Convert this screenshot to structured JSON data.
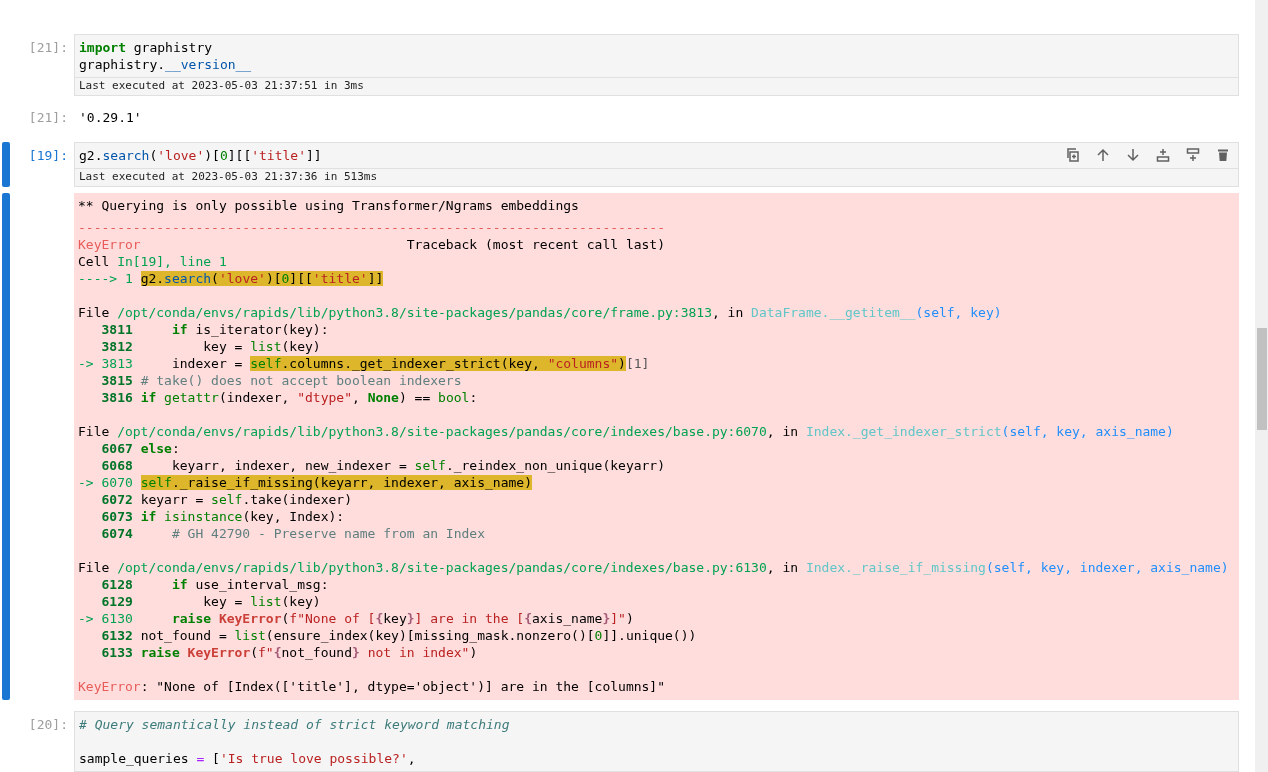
{
  "cells": [
    {
      "kind": "code",
      "prompt": "[21]:",
      "active": false,
      "show_toolbar": false,
      "status": "Last executed at 2023-05-03 21:37:51 in 3ms",
      "blocks": [
        [
          [
            {
              "kind": "kw",
              "text": "import"
            },
            {
              "kind": "plain",
              "text": " graphistry"
            }
          ],
          [
            {
              "kind": "plain",
              "text": "graphistry."
            },
            {
              "kind": "attr",
              "text": "__version__"
            }
          ]
        ]
      ]
    },
    {
      "kind": "result",
      "prompt": "[21]:",
      "active": false,
      "text": "'0.29.1'"
    },
    {
      "kind": "code",
      "prompt": "[19]:",
      "active": true,
      "show_toolbar": true,
      "status": "Last executed at 2023-05-03 21:37:36 in 513ms",
      "blocks": [
        [
          [
            {
              "kind": "plain",
              "text": "g2."
            },
            {
              "kind": "attr",
              "text": "search"
            },
            {
              "kind": "plain",
              "text": "("
            },
            {
              "kind": "str",
              "text": "'love'"
            },
            {
              "kind": "plain",
              "text": ")["
            },
            {
              "kind": "num",
              "text": "0"
            },
            {
              "kind": "plain",
              "text": "][["
            },
            {
              "kind": "str",
              "text": "'title'"
            },
            {
              "kind": "plain",
              "text": "]]"
            }
          ]
        ]
      ]
    },
    {
      "kind": "error",
      "active": true,
      "blocks": [
        [
          [
            {
              "kind": "plain",
              "text": "** Querying is only possible using Transformer/Ngrams embeddings"
            }
          ],
          [
            {
              "kind": "ared",
              "text": "---------------------------------------------------------------------------"
            }
          ],
          [
            {
              "kind": "ared",
              "text": "KeyError"
            },
            {
              "kind": "plain",
              "text": "                                  Traceback (most recent call last)"
            }
          ],
          [
            {
              "kind": "plain",
              "text": "Cell "
            },
            {
              "kind": "agreen",
              "text": "In[19], line 1"
            }
          ],
          [
            {
              "kind": "agreen",
              "text": "----> 1 "
            },
            {
              "kind": "plain",
              "text": "g2.",
              "highlighted": true
            },
            {
              "kind": "attr",
              "text": "search",
              "highlighted": true
            },
            {
              "kind": "plain",
              "text": "(",
              "highlighted": true
            },
            {
              "kind": "str",
              "text": "'love'",
              "highlighted": true
            },
            {
              "kind": "plain",
              "text": ")[",
              "highlighted": true
            },
            {
              "kind": "num",
              "text": "0",
              "highlighted": true
            },
            {
              "kind": "plain",
              "text": "][[",
              "highlighted": true
            },
            {
              "kind": "str",
              "text": "'title'",
              "highlighted": true
            },
            {
              "kind": "plain",
              "text": "]]",
              "highlighted": true
            }
          ]
        ],
        [
          [
            {
              "kind": "plain",
              "text": "File "
            },
            {
              "kind": "agreen",
              "text": "/opt/conda/envs/rapids/lib/python3.8/site-packages/pandas/core/frame.py:3813"
            },
            {
              "kind": "plain",
              "text": ", in "
            },
            {
              "kind": "acyan",
              "text": "DataFrame.__getitem__"
            },
            {
              "kind": "ablue",
              "text": "(self, key)"
            }
          ],
          [
            {
              "kind": "lineno",
              "text": "   3811     "
            },
            {
              "kind": "kw",
              "text": "if"
            },
            {
              "kind": "plain",
              "text": " is_iterator(key):"
            }
          ],
          [
            {
              "kind": "lineno",
              "text": "   3812         "
            },
            {
              "kind": "plain",
              "text": "key = "
            },
            {
              "kind": "builtin",
              "text": "list"
            },
            {
              "kind": "plain",
              "text": "(key)"
            }
          ],
          [
            {
              "kind": "agreen",
              "text": "-> 3813     "
            },
            {
              "kind": "plain",
              "text": "indexer = "
            },
            {
              "kind": "builtin",
              "text": "self",
              "highlighted": true
            },
            {
              "kind": "plain",
              "text": ".columns._get_indexer_strict(key, ",
              "highlighted": true
            },
            {
              "kind": "str",
              "text": "\"columns\"",
              "highlighted": true
            },
            {
              "kind": "plain",
              "text": ")",
              "highlighted": true
            },
            {
              "kind": "dim",
              "text": "[1]"
            }
          ],
          [
            {
              "kind": "lineno",
              "text": "   3815 "
            },
            {
              "kind": "comment",
              "text": "# take() does not accept boolean indexers"
            }
          ],
          [
            {
              "kind": "lineno",
              "text": "   3816 "
            },
            {
              "kind": "kw",
              "text": "if"
            },
            {
              "kind": "builtin",
              "text": " getattr"
            },
            {
              "kind": "plain",
              "text": "(indexer, "
            },
            {
              "kind": "str",
              "text": "\"dtype\""
            },
            {
              "kind": "plain",
              "text": ", "
            },
            {
              "kind": "kw",
              "text": "None"
            },
            {
              "kind": "plain",
              "text": ") == "
            },
            {
              "kind": "builtin",
              "text": "bool"
            },
            {
              "kind": "plain",
              "text": ":"
            }
          ]
        ],
        [
          [
            {
              "kind": "plain",
              "text": "File "
            },
            {
              "kind": "agreen",
              "text": "/opt/conda/envs/rapids/lib/python3.8/site-packages/pandas/core/indexes/base.py:6070"
            },
            {
              "kind": "plain",
              "text": ", in "
            },
            {
              "kind": "acyan",
              "text": "Index._get_indexer_strict"
            },
            {
              "kind": "ablue",
              "text": "(self, key, axis_name)"
            }
          ],
          [
            {
              "kind": "lineno",
              "text": "   6067 "
            },
            {
              "kind": "kw",
              "text": "else"
            },
            {
              "kind": "plain",
              "text": ":"
            }
          ],
          [
            {
              "kind": "lineno",
              "text": "   6068     "
            },
            {
              "kind": "plain",
              "text": "keyarr, indexer, new_indexer = "
            },
            {
              "kind": "builtin",
              "text": "self"
            },
            {
              "kind": "plain",
              "text": "._reindex_non_unique(keyarr)"
            }
          ],
          [
            {
              "kind": "agreen",
              "text": "-> 6070 "
            },
            {
              "kind": "builtin",
              "text": "self",
              "highlighted": true
            },
            {
              "kind": "plain",
              "text": "._raise_if_missing(keyarr, indexer, axis_name)",
              "highlighted": true
            }
          ],
          [
            {
              "kind": "lineno",
              "text": "   6072 "
            },
            {
              "kind": "plain",
              "text": "keyarr = "
            },
            {
              "kind": "builtin",
              "text": "self"
            },
            {
              "kind": "plain",
              "text": ".take(indexer)"
            }
          ],
          [
            {
              "kind": "lineno",
              "text": "   6073 "
            },
            {
              "kind": "kw",
              "text": "if"
            },
            {
              "kind": "builtin",
              "text": " isinstance"
            },
            {
              "kind": "plain",
              "text": "(key, Index):"
            }
          ],
          [
            {
              "kind": "lineno",
              "text": "   6074     "
            },
            {
              "kind": "comment",
              "text": "# GH 42790 - Preserve name from an Index"
            }
          ]
        ],
        [
          [
            {
              "kind": "plain",
              "text": "File "
            },
            {
              "kind": "agreen",
              "text": "/opt/conda/envs/rapids/lib/python3.8/site-packages/pandas/core/indexes/base.py:6130"
            },
            {
              "kind": "plain",
              "text": ", in "
            },
            {
              "kind": "acyan",
              "text": "Index._raise_if_missing"
            },
            {
              "kind": "ablue",
              "text": "(self, key, indexer, axis_name)"
            }
          ],
          [
            {
              "kind": "lineno",
              "text": "   6128     "
            },
            {
              "kind": "kw",
              "text": "if"
            },
            {
              "kind": "plain",
              "text": " use_interval_msg:"
            }
          ],
          [
            {
              "kind": "lineno",
              "text": "   6129         "
            },
            {
              "kind": "plain",
              "text": "key = "
            },
            {
              "kind": "builtin",
              "text": "list"
            },
            {
              "kind": "plain",
              "text": "(key)"
            }
          ],
          [
            {
              "kind": "agreen",
              "text": "-> 6130     "
            },
            {
              "kind": "kw",
              "text": "raise"
            },
            {
              "kind": "exc",
              "text": " KeyError"
            },
            {
              "kind": "plain",
              "text": "("
            },
            {
              "kind": "str",
              "text": "f\"None of ["
            },
            {
              "kind": "interp",
              "text": "{"
            },
            {
              "kind": "plain",
              "text": "key"
            },
            {
              "kind": "interp",
              "text": "}"
            },
            {
              "kind": "str",
              "text": "] are in the ["
            },
            {
              "kind": "interp",
              "text": "{"
            },
            {
              "kind": "plain",
              "text": "axis_name"
            },
            {
              "kind": "interp",
              "text": "}"
            },
            {
              "kind": "str",
              "text": "]\""
            },
            {
              "kind": "plain",
              "text": ")"
            }
          ],
          [
            {
              "kind": "lineno",
              "text": "   6132 "
            },
            {
              "kind": "plain",
              "text": "not_found = "
            },
            {
              "kind": "builtin",
              "text": "list"
            },
            {
              "kind": "plain",
              "text": "(ensure_index(key)[missing_mask.nonzero()["
            },
            {
              "kind": "num",
              "text": "0"
            },
            {
              "kind": "plain",
              "text": "]].unique())"
            }
          ],
          [
            {
              "kind": "lineno",
              "text": "   6133 "
            },
            {
              "kind": "kw",
              "text": "raise"
            },
            {
              "kind": "exc",
              "text": " KeyError"
            },
            {
              "kind": "plain",
              "text": "("
            },
            {
              "kind": "str",
              "text": "f\""
            },
            {
              "kind": "interp",
              "text": "{"
            },
            {
              "kind": "plain",
              "text": "not_found"
            },
            {
              "kind": "interp",
              "text": "}"
            },
            {
              "kind": "str",
              "text": " not in index\""
            },
            {
              "kind": "plain",
              "text": ")"
            }
          ]
        ],
        [
          [
            {
              "kind": "ared",
              "text": "KeyError"
            },
            {
              "kind": "plain",
              "text": ": \"None of [Index(['title'], dtype='object')] are in the [columns]\""
            }
          ]
        ]
      ]
    },
    {
      "kind": "code",
      "prompt": "[20]:",
      "active": false,
      "show_toolbar": false,
      "blocks": [
        [
          [
            {
              "kind": "comment_it",
              "text": "# Query semantically instead of strict keyword matching"
            }
          ]
        ],
        [
          [
            {
              "kind": "plain",
              "text": "sample_queries "
            },
            {
              "kind": "op",
              "text": "="
            },
            {
              "kind": "plain",
              "text": " ["
            },
            {
              "kind": "str",
              "text": "'Is true love possible?'"
            },
            {
              "kind": "plain",
              "text": ","
            }
          ]
        ]
      ]
    }
  ]
}
